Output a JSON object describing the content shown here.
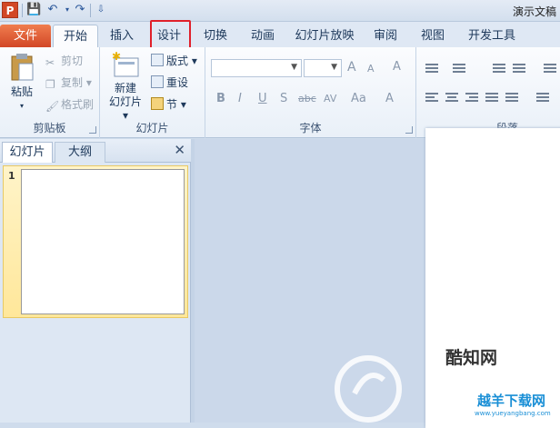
{
  "qat": {
    "app_icon": "P",
    "save": "💾",
    "undo": "↶",
    "redo": "↷",
    "customize": "⇩",
    "title": "演示文稿"
  },
  "tabs": [
    "文件",
    "开始",
    "插入",
    "设计",
    "切换",
    "动画",
    "幻灯片放映",
    "审阅",
    "视图",
    "开发工具"
  ],
  "active_tab": "开始",
  "highlighted_tab": "设计",
  "clipboard": {
    "paste": "粘贴",
    "cut": "剪切",
    "copy": "复制",
    "format_painter": "格式刷",
    "label": "剪贴板"
  },
  "slides_group": {
    "new_slide_line1": "新建",
    "new_slide_line2": "幻灯片",
    "layout": "版式",
    "reset": "重设",
    "section": "节",
    "label": "幻灯片"
  },
  "font_group": {
    "grow": "A",
    "shrink": "A",
    "clear": "A",
    "bold": "B",
    "italic": "I",
    "underline": "U",
    "shadow": "S",
    "strike": "abc",
    "spacing": "AV",
    "case": "Aa",
    "color": "A",
    "label": "字体"
  },
  "paragraph_group": {
    "label": "段落"
  },
  "pane": {
    "tab_slides": "幻灯片",
    "tab_outline": "大纲",
    "close": "✕",
    "thumb_number": "1"
  },
  "watermark": {
    "brand1": "酷知网",
    "brand2": "越羊下载网",
    "url": "www.yueyangbang.com"
  },
  "colors": {
    "file_tab": "#d24726",
    "highlight": "#e0202a",
    "ribbon": "#fbfcfe",
    "workspace": "#cbd8ea"
  }
}
